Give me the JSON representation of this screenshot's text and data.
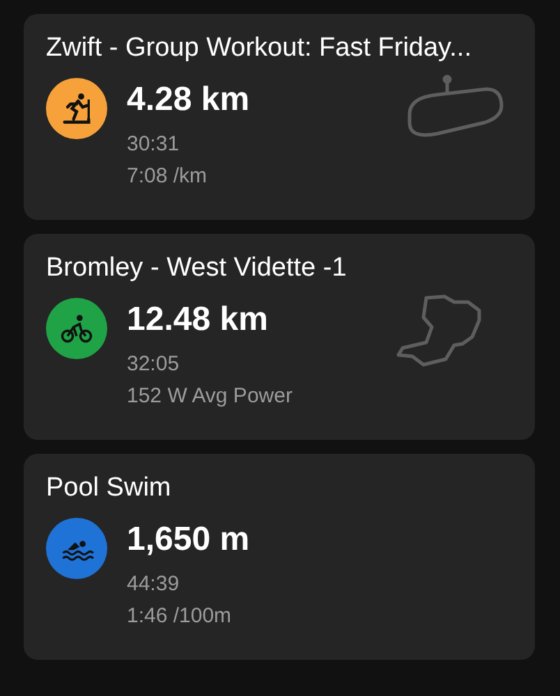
{
  "activities": [
    {
      "title": "Zwift - Group Workout: Fast Friday...",
      "kind": "run",
      "distance": "4.28 km",
      "stats": [
        "30:31",
        "7:08 /km"
      ],
      "route_map": true
    },
    {
      "title": "Bromley - West Vidette -1",
      "kind": "ride",
      "distance": "12.48 km",
      "stats": [
        "32:05",
        "152 W Avg Power"
      ],
      "route_map": true
    },
    {
      "title": "Pool Swim",
      "kind": "swim",
      "distance": "1,650 m",
      "stats": [
        "44:39",
        "1:46 /100m"
      ]
    }
  ]
}
